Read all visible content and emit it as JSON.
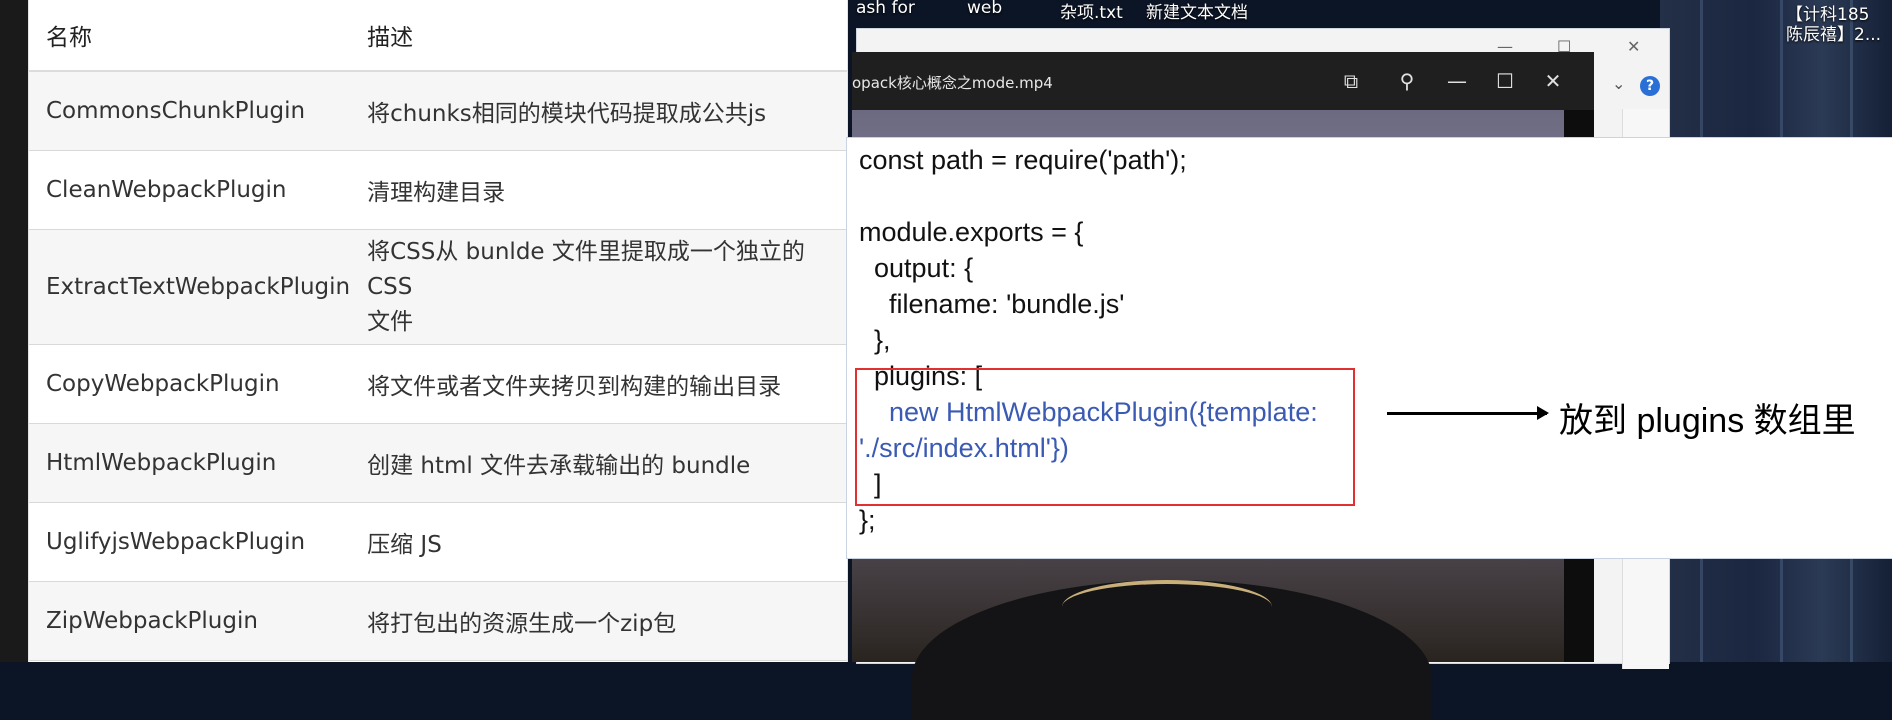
{
  "desktop": {
    "labels": [
      "ash for",
      "web",
      "杂项.txt",
      "新建文本文档",
      "【计科185",
      "陈辰禧】2..."
    ]
  },
  "player": {
    "title": "opack核心概念之mode.mp4"
  },
  "table": {
    "headers": [
      "名称",
      "描述"
    ],
    "rows": [
      {
        "name": "CommonsChunkPlugin",
        "desc": "将chunks相同的模块代码提取成公共js"
      },
      {
        "name": "CleanWebpackPlugin",
        "desc": "清理构建目录"
      },
      {
        "name": "ExtractTextWebpackPlugin",
        "desc_1": "将CSS从 bunlde 文件里提取成一个独立的CSS",
        "desc_2": "文件"
      },
      {
        "name": "CopyWebpackPlugin",
        "desc": "将文件或者文件夹拷贝到构建的输出目录"
      },
      {
        "name": "HtmlWebpackPlugin",
        "desc": "创建 html 文件去承载输出的 bundle"
      },
      {
        "name": "UglifyjsWebpackPlugin",
        "desc": "压缩 JS"
      },
      {
        "name": "ZipWebpackPlugin",
        "desc": "将打包出的资源生成一个zip包"
      }
    ]
  },
  "slide": {
    "code_lines": [
      "const path = require('path');",
      "",
      "module.exports = {",
      "  output: {",
      "    filename: 'bundle.js'",
      "  },",
      "  plugins: ["
    ],
    "highlight_1": "    new HtmlWebpackPlugin({template:",
    "highlight_2": "'./src/index.html'})",
    "code_tail_1": "  ]",
    "code_tail_2": "};",
    "annotation": "放到 plugins 数组里",
    "highlight_color": "#3a5ab3",
    "box_color": "#e03030"
  }
}
